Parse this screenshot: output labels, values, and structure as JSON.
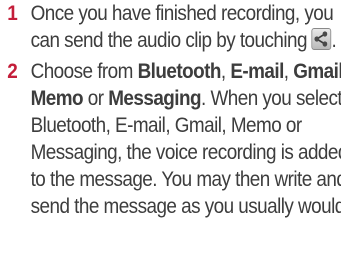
{
  "steps": [
    {
      "number": "1",
      "text_before_icon": "Once you have finished recording, you can send the audio clip by touching ",
      "icon": "share-icon",
      "text_after_icon": "."
    },
    {
      "number": "2",
      "intro": "Choose from ",
      "option_1": "Bluetooth",
      "sep_1": ", ",
      "option_2": "E-mail",
      "sep_2": ", ",
      "option_3": "Gmail",
      "sep_3": ", ",
      "option_4": "Memo",
      "sep_4": " or ",
      "option_5": "Messaging",
      "body": ". When you select Bluetooth, E-mail, Gmail, Memo or Messaging, the voice recording is added to the message. You may then write and send the message as you usually would."
    }
  ]
}
